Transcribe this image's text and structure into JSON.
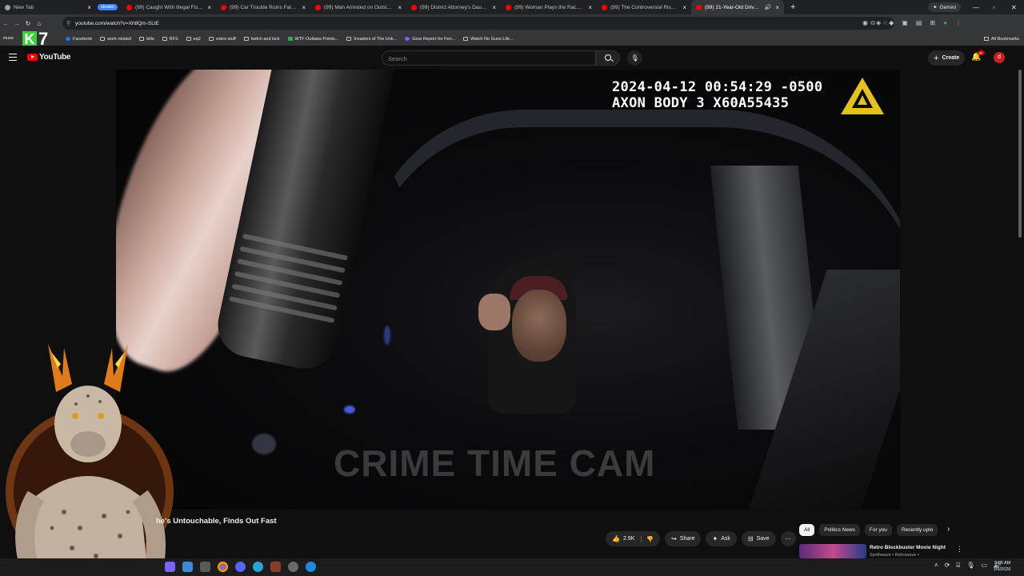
{
  "browser": {
    "tabs": [
      {
        "title": "New Tab",
        "icon": "chrome-icon"
      },
      {
        "title": "stream",
        "group": true
      },
      {
        "title": "(99) Caught With Illegal Fish in",
        "icon": "youtube-icon"
      },
      {
        "title": "(99) Car Trouble Ruins Father's",
        "icon": "youtube-icon"
      },
      {
        "title": "(99) Man Arrested on Outstand",
        "icon": "youtube-icon"
      },
      {
        "title": "(99) District Attorney's Daughte",
        "icon": "youtube-icon"
      },
      {
        "title": "(99) Woman Plays the Race Car",
        "icon": "youtube-icon"
      },
      {
        "title": "(99) The Controversial Rise & F",
        "icon": "youtube-icon"
      },
      {
        "title": "(99) 21-Year-Old Driver Thi",
        "icon": "youtube-icon",
        "active": true
      }
    ],
    "gemini_label": "Gemini",
    "url": "youtube.com/watch?v=Xh8Qm-SLtE",
    "bookmarks": [
      {
        "label": "Facebook",
        "icon": "facebook-icon"
      },
      {
        "label": "work related",
        "icon": "folder-icon"
      },
      {
        "label": "bills",
        "icon": "folder-icon"
      },
      {
        "label": "RFS",
        "icon": "folder-icon"
      },
      {
        "label": "eq2",
        "icon": "folder-icon"
      },
      {
        "label": "video stuff",
        "icon": "folder-icon"
      },
      {
        "label": "twitch and kick",
        "icon": "folder-icon"
      },
      {
        "label": "WTF Outlaws Points...",
        "icon": "site-icon"
      },
      {
        "label": "Invaders of The Unk...",
        "icon": "site-icon"
      },
      {
        "label": "Gear Report for Fen...",
        "icon": "site-icon"
      },
      {
        "label": "Watch No Guns Life...",
        "icon": "site-icon"
      }
    ],
    "all_bookmarks": "All Bookmarks"
  },
  "overlay": {
    "music_label": "music",
    "k_letter": "K",
    "seven": "7"
  },
  "youtube": {
    "logo_text": "YouTube",
    "search_placeholder": "Search",
    "create_label": "Create",
    "notif_badge": "9+",
    "avatar_letter": "d"
  },
  "video": {
    "timestamp_line1": "2024-04-12 00:54:29 -0500",
    "timestamp_line2": "AXON BODY 3 X60A55435",
    "watermark": "CRIME TIME CAM",
    "title_visible": "he's Untouchable, Finds Out Fast"
  },
  "actions": {
    "likes": "2.9K",
    "share": "Share",
    "ask": "Ask",
    "save": "Save"
  },
  "chips": [
    "All",
    "Politics News",
    "For you",
    "Recently uplo"
  ],
  "recommendation": {
    "title": "Retro Blockbuster Movie Night",
    "subtitle": "Synthwave • Retrowave •"
  },
  "clock": {
    "time": "5:05 AM",
    "date": "1/6/2026"
  },
  "colors": {
    "yt_red": "#ff0000",
    "bg": "#0f0f0f",
    "chip_bg": "#272727"
  }
}
